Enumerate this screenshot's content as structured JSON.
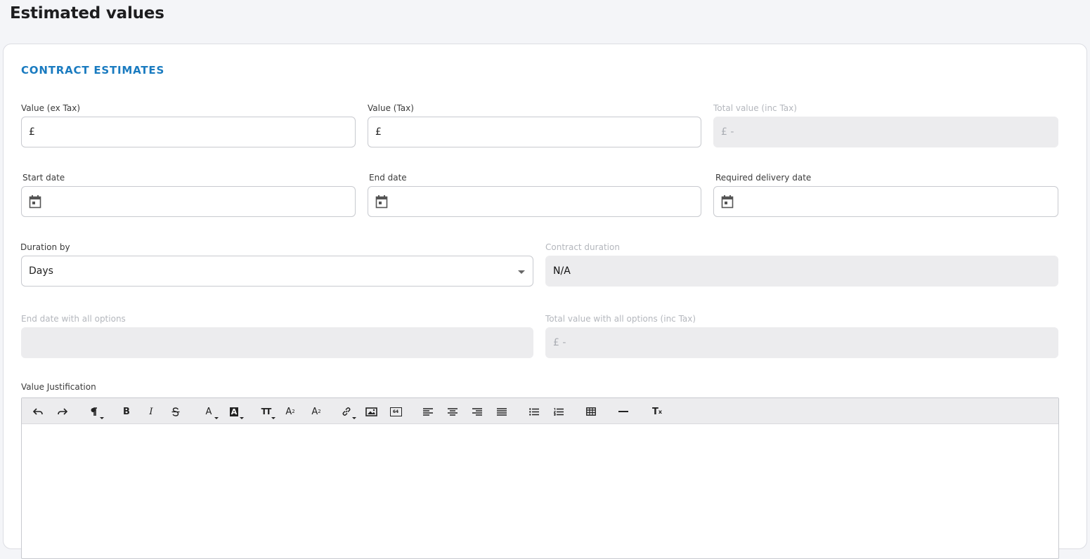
{
  "page": {
    "title": "Estimated values"
  },
  "section": {
    "title": "CONTRACT ESTIMATES"
  },
  "fields": {
    "value_ex_tax": {
      "label": "Value (ex Tax)",
      "value": "£"
    },
    "value_tax": {
      "label": "Value (Tax)",
      "value": "£"
    },
    "total_value": {
      "label": "Total value (inc Tax)",
      "value": "£ -"
    },
    "start_date": {
      "label": "Start date",
      "value": ""
    },
    "end_date": {
      "label": "End date",
      "value": ""
    },
    "required_delivery_date": {
      "label": "Required delivery date",
      "value": ""
    },
    "duration_by": {
      "label": "Duration by",
      "value": "Days"
    },
    "contract_duration": {
      "label": "Contract duration",
      "value": "N/A"
    },
    "end_date_all_options": {
      "label": "End date with all options",
      "value": ""
    },
    "total_value_all_options": {
      "label": "Total value with all options (inc Tax)",
      "value": "£ -"
    },
    "value_justification": {
      "label": "Value Justification"
    }
  },
  "toolbar": {
    "icons": [
      "undo-icon",
      "redo-icon",
      "paragraph-format-icon",
      "bold-icon",
      "italic-icon",
      "strikethrough-icon",
      "text-color-icon",
      "background-color-icon",
      "font-size-icon",
      "superscript-icon",
      "subscript-icon",
      "link-icon",
      "image-icon",
      "base64-image-icon",
      "align-left-icon",
      "align-center-icon",
      "align-right-icon",
      "align-justify-icon",
      "bullet-list-icon",
      "numbered-list-icon",
      "table-icon",
      "horizontal-rule-icon",
      "clear-format-icon"
    ],
    "bold_glyph": "B",
    "italic_glyph": "I",
    "text_color_glyph": "A",
    "bg_color_glyph": "A",
    "font_size_glyph": "TT",
    "superscript_glyph": "A",
    "subscript_glyph": "A",
    "clear_glyph": "T",
    "base64_glyph": "64"
  },
  "colors": {
    "accent": "#1a7bc0",
    "disabled_bg": "#ececee",
    "page_bg": "#f4f5f8"
  }
}
